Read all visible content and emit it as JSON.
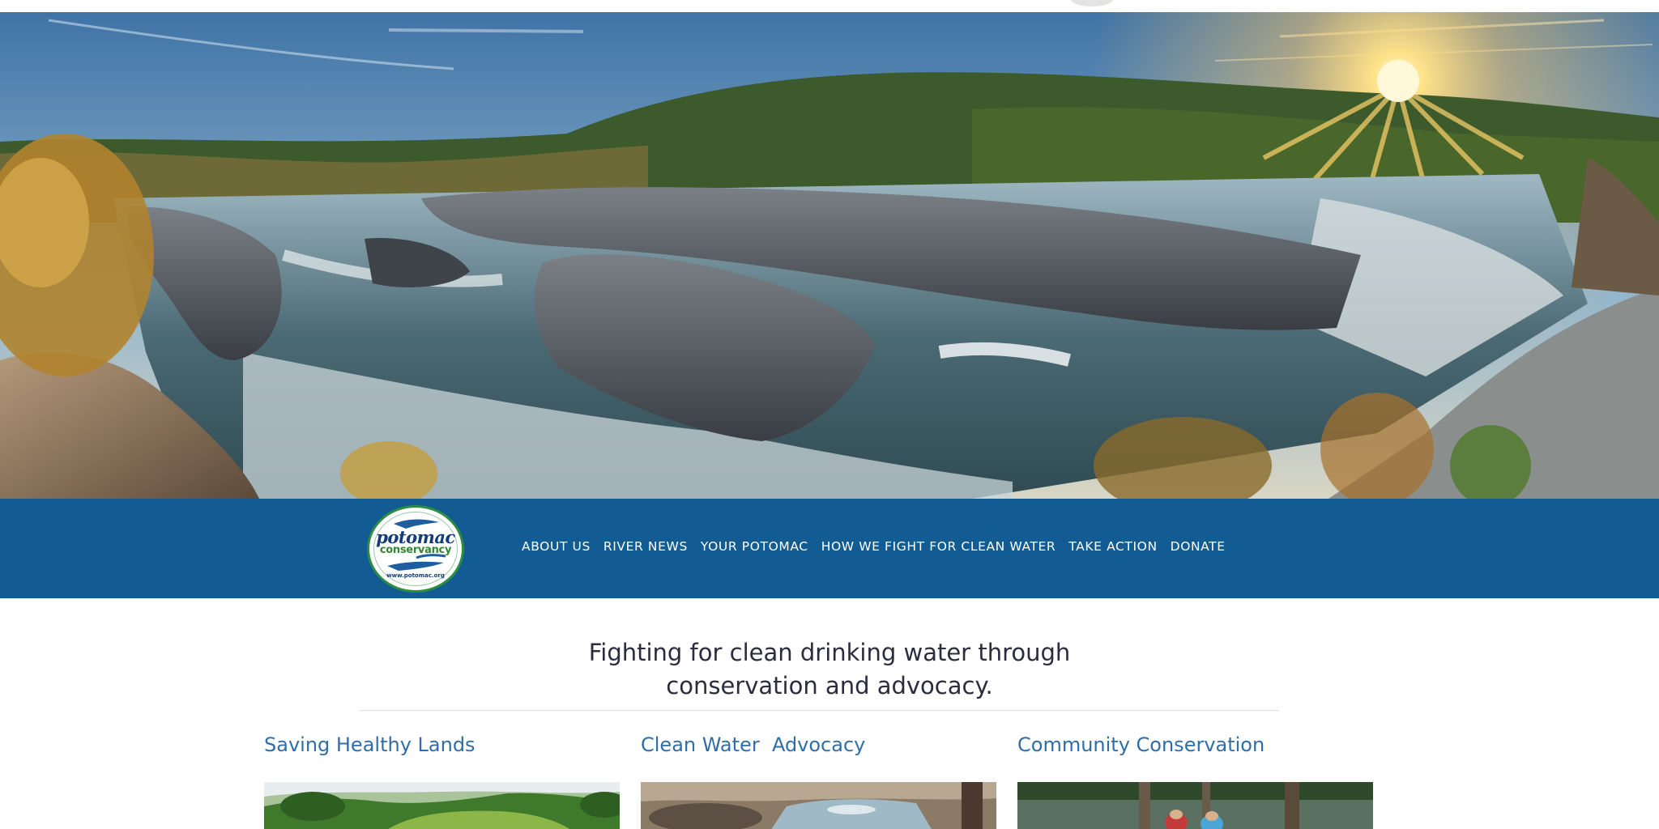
{
  "hero": {
    "description_icon": "river-falls-landscape-photo"
  },
  "logo": {
    "line1": "potomac",
    "line2": "conservancy",
    "url": "www.potomac.org"
  },
  "nav": {
    "items": [
      {
        "label": "ABOUT US"
      },
      {
        "label": "RIVER NEWS"
      },
      {
        "label": "YOUR POTOMAC"
      },
      {
        "label": "HOW WE FIGHT FOR CLEAN WATER"
      },
      {
        "label": "TAKE ACTION"
      },
      {
        "label": "DONATE"
      }
    ]
  },
  "tagline": {
    "line1": "Fighting for clean drinking water through",
    "line2": "conservation and advocacy."
  },
  "columns": [
    {
      "title": "Saving Healthy Lands",
      "image_icon": "green-hills-photo"
    },
    {
      "title": "Clean Water  Advocacy",
      "image_icon": "rocky-stream-photo"
    },
    {
      "title": "Community Conservation",
      "image_icon": "volunteers-photo"
    }
  ],
  "colors": {
    "nav_bg": "#125c93",
    "title_blue": "#2f6ea8",
    "logo_green": "#2e8d43",
    "logo_navy": "#133b78"
  }
}
